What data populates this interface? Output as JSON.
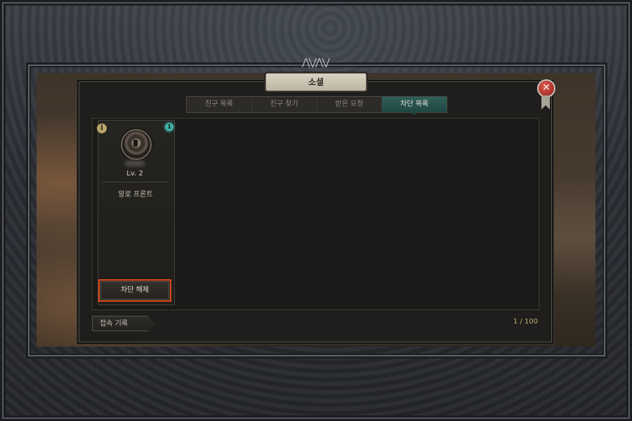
{
  "dialog": {
    "title": "소셜",
    "close_icon": "close-icon"
  },
  "tabs": [
    {
      "label": "친구 목록",
      "active": false
    },
    {
      "label": "친구 찾기",
      "active": false
    },
    {
      "label": "받은 요청",
      "active": false
    },
    {
      "label": "차단 목록",
      "active": true
    }
  ],
  "card": {
    "info_icon": "i",
    "badge": "1",
    "level": "Lv. 2",
    "location": "말로 프론트",
    "unblock_label": "차단 해제"
  },
  "footer": {
    "history_label": "접속 기록",
    "count": "1 / 100"
  },
  "colors": {
    "active_tab": "#2f5f5a",
    "highlight_outline": "#e04a1f",
    "badge": "#3fb3a4"
  }
}
